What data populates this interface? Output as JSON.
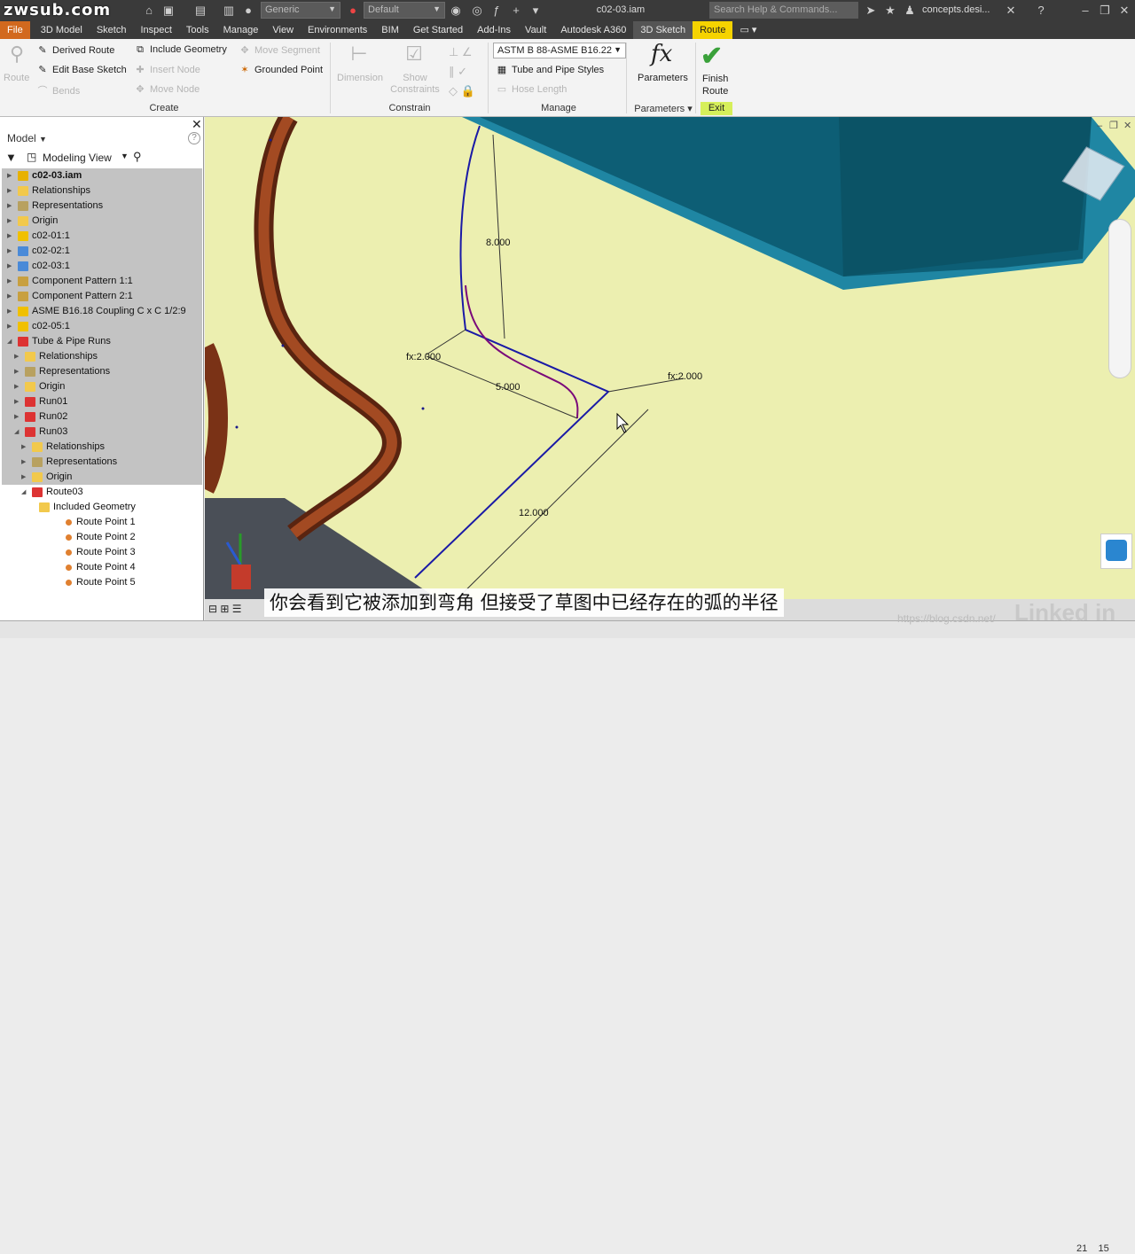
{
  "titlebar": {
    "logo": "zwsub.com",
    "material_combo": "Generic",
    "appearance_combo": "Default",
    "document_title": "c02-03.iam",
    "search_placeholder": "Search Help & Commands...",
    "user": "concepts.desi..."
  },
  "menubar": {
    "items": [
      "File",
      "3D Model",
      "Sketch",
      "Inspect",
      "Tools",
      "Manage",
      "View",
      "Environments",
      "BIM",
      "Get Started",
      "Add-Ins",
      "Vault",
      "Autodesk A360",
      "3D Sketch",
      "Route"
    ],
    "active": "Route"
  },
  "ribbon": {
    "create": {
      "route": "Route",
      "derived_route": "Derived Route",
      "edit_base_sketch": "Edit Base Sketch",
      "bends": "Bends",
      "include_geometry": "Include Geometry",
      "insert_node": "Insert Node",
      "move_node": "Move Node",
      "move_segment": "Move Segment",
      "grounded_point": "Grounded Point",
      "title": "Create"
    },
    "constrain": {
      "dimension": "Dimension",
      "show_constraints": "Show Constraints",
      "title": "Constrain"
    },
    "manage": {
      "style": "ASTM B 88-ASME B16.22",
      "tube_pipe_styles": "Tube and Pipe Styles",
      "hose_length": "Hose Length",
      "title": "Manage"
    },
    "parameters": {
      "label": "Parameters",
      "title": "Parameters"
    },
    "exit": {
      "finish_route_1": "Finish",
      "finish_route_2": "Route",
      "title": "Exit"
    }
  },
  "browser": {
    "header": "Model",
    "view": "Modeling View",
    "tree": [
      {
        "label": "c02-03.iam",
        "level": 0,
        "icon": "assembly",
        "bold": true,
        "sel": true
      },
      {
        "label": "Relationships",
        "level": 0,
        "icon": "folder",
        "sel": true
      },
      {
        "label": "Representations",
        "level": 0,
        "icon": "reps",
        "sel": true
      },
      {
        "label": "Origin",
        "level": 0,
        "icon": "folder",
        "sel": true
      },
      {
        "label": "c02-01:1",
        "level": 0,
        "icon": "part",
        "sel": true
      },
      {
        "label": "c02-02:1",
        "level": 0,
        "icon": "sketch-part",
        "sel": true
      },
      {
        "label": "c02-03:1",
        "level": 0,
        "icon": "sketch-part",
        "sel": true
      },
      {
        "label": "Component Pattern 1:1",
        "level": 0,
        "icon": "pattern",
        "sel": true
      },
      {
        "label": "Component Pattern 2:1",
        "level": 0,
        "icon": "pattern",
        "sel": true
      },
      {
        "label": "ASME B16.18 Coupling C x C 1/2:9",
        "level": 0,
        "icon": "part",
        "sel": true
      },
      {
        "label": "c02-05:1",
        "level": 0,
        "icon": "part",
        "sel": true
      },
      {
        "label": "Tube & Pipe Runs",
        "level": 0,
        "icon": "runs",
        "sel": true,
        "open": true
      },
      {
        "label": "Relationships",
        "level": 1,
        "icon": "folder",
        "sel": true
      },
      {
        "label": "Representations",
        "level": 1,
        "icon": "reps",
        "sel": true
      },
      {
        "label": "Origin",
        "level": 1,
        "icon": "folder",
        "sel": true
      },
      {
        "label": "Run01",
        "level": 1,
        "icon": "runs",
        "sel": true
      },
      {
        "label": "Run02",
        "level": 1,
        "icon": "runs",
        "sel": true
      },
      {
        "label": "Run03",
        "level": 1,
        "icon": "runs",
        "sel": true,
        "open": true
      },
      {
        "label": "Relationships",
        "level": 2,
        "icon": "folder",
        "sel": true
      },
      {
        "label": "Representations",
        "level": 2,
        "icon": "reps",
        "sel": true
      },
      {
        "label": "Origin",
        "level": 2,
        "icon": "folder",
        "sel": true
      },
      {
        "label": "Route03",
        "level": 2,
        "icon": "route",
        "open": true
      },
      {
        "label": "Included Geometry",
        "level": 3,
        "icon": "folder"
      },
      {
        "label": "Route Point 1",
        "level": 3,
        "icon": "point"
      },
      {
        "label": "Route Point 2",
        "level": 3,
        "icon": "point"
      },
      {
        "label": "Route Point 3",
        "level": 3,
        "icon": "point"
      },
      {
        "label": "Route Point 4",
        "level": 3,
        "icon": "point"
      },
      {
        "label": "Route Point 5",
        "level": 3,
        "icon": "point"
      }
    ]
  },
  "viewport": {
    "dimensions": {
      "d_top": "8.000",
      "fx_left": "fx:2.000",
      "d_mid": "5.000",
      "fx_right": "fx:2.000",
      "d_bottom": "12.000"
    }
  },
  "subtitle": "你会看到它被添加到弯角  但接受了草图中已经存在的弧的半径",
  "watermark": "https://blog.csdn.net/",
  "linkedin": "Linked in",
  "page_numbers": {
    "left": "21",
    "right": "15"
  },
  "colors": {
    "file_tab": "#d2691e",
    "route_tab": "#f5d300",
    "viewport": "#ecefb0",
    "pipe": "#8b3a1e",
    "box": "#157a95",
    "route_line": "#1a1aa6",
    "arc": "#7a0a7a"
  }
}
